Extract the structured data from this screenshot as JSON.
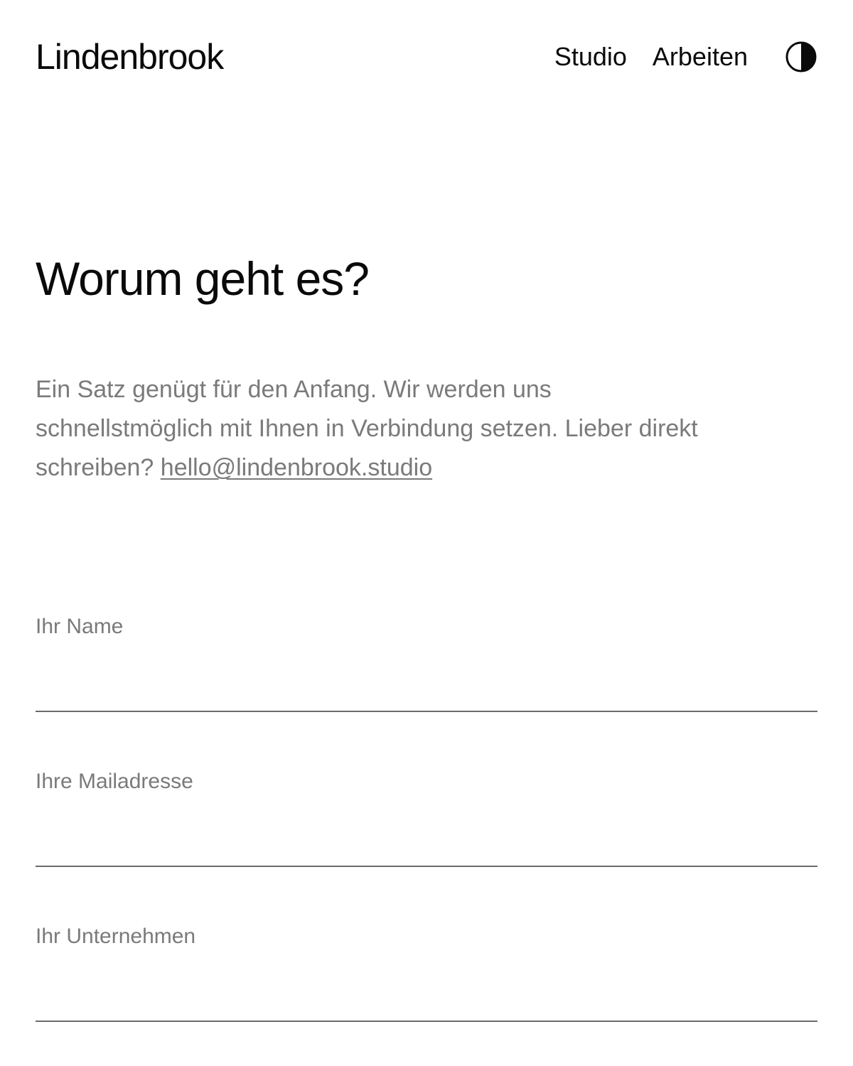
{
  "header": {
    "logo": "Lindenbrook",
    "nav": [
      {
        "label": "Studio"
      },
      {
        "label": "Arbeiten"
      }
    ],
    "theme_toggle_icon": "half-circle-contrast-icon"
  },
  "main": {
    "headline": "Worum geht es?",
    "intro_text": "Ein Satz genügt für den Anfang. Wir werden uns schnellstmöglich mit Ihnen in Verbindung setzen. Lieber direkt schreiben? ",
    "email_link": "hello@lindenbrook.studio"
  },
  "form": {
    "fields": [
      {
        "label": "Ihr Name",
        "value": ""
      },
      {
        "label": "Ihre Mailadresse",
        "value": ""
      },
      {
        "label": "Ihr Unternehmen",
        "value": ""
      }
    ]
  },
  "colors": {
    "text": "#0a0a0a",
    "muted": "#7a7a7a",
    "rule": "#6b6b6b",
    "background": "#ffffff"
  }
}
